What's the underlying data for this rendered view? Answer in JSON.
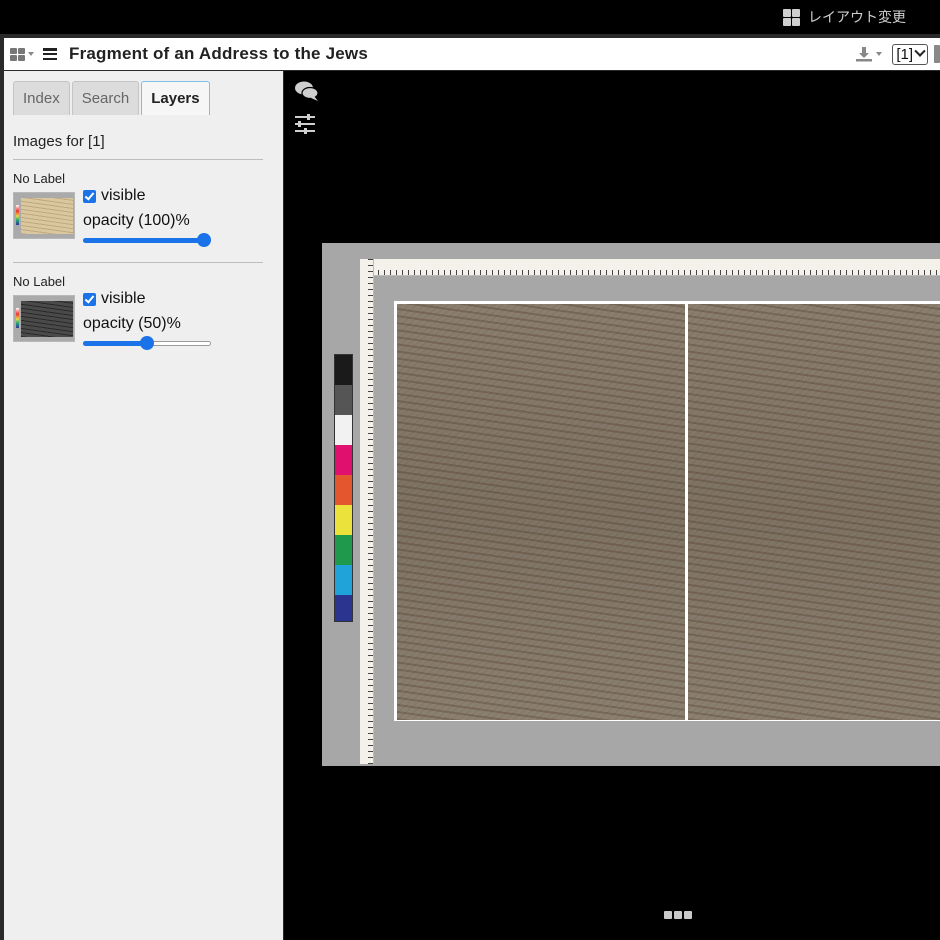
{
  "topbar": {
    "layout_label": "レイアウト変更",
    "layout_icon": "grid-icon"
  },
  "window": {
    "title": "Fragment of an Address to the Jews",
    "canvas_selector": "[1]",
    "download_icon": "download-icon",
    "info_icon": "info-icon"
  },
  "sidebar": {
    "tabs": [
      {
        "label": "Index",
        "active": false
      },
      {
        "label": "Search",
        "active": false
      },
      {
        "label": "Layers",
        "active": true
      }
    ],
    "images_for": "Images for [1]",
    "layers": [
      {
        "label": "No Label",
        "visible_label": "visible",
        "visible": true,
        "opacity_text": "opacity (100)%",
        "opacity": 100
      },
      {
        "label": "No Label",
        "visible_label": "visible",
        "visible": true,
        "opacity_text": "opacity (50)%",
        "opacity": 50
      }
    ]
  },
  "viewer": {
    "icons": [
      "comments-icon",
      "sliders-icon"
    ],
    "pager_icon": "ellipsis-icon"
  },
  "colors": {
    "accent": "#1a73e8",
    "sidebar_bg": "#efefef",
    "viewer_bg": "#000000"
  }
}
